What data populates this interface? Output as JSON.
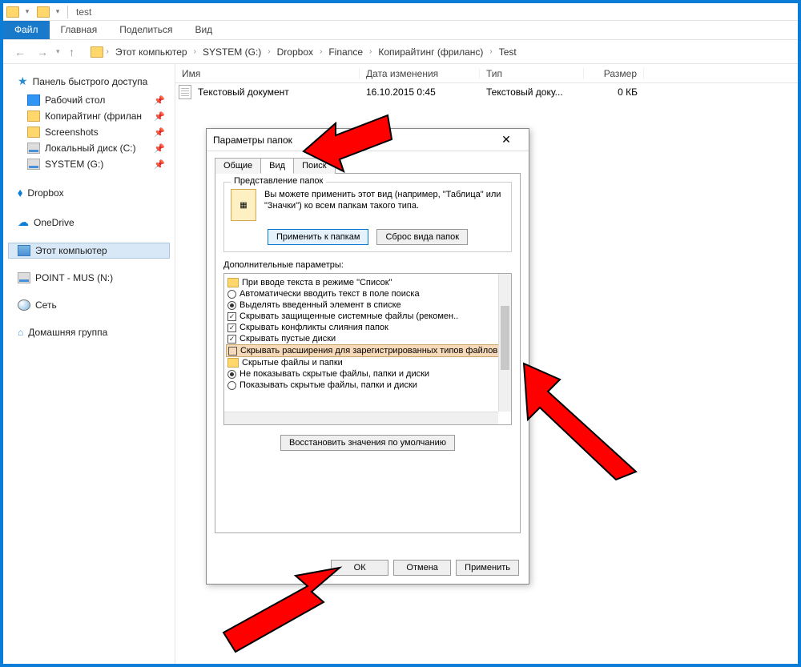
{
  "title": "test",
  "ribbon": {
    "file": "Файл",
    "home": "Главная",
    "share": "Поделиться",
    "view": "Вид"
  },
  "breadcrumb": [
    "Этот компьютер",
    "SYSTEM (G:)",
    "Dropbox",
    "Finance",
    "Копирайтинг (фриланс)",
    "Test"
  ],
  "columns": {
    "name": "Имя",
    "date": "Дата изменения",
    "type": "Тип",
    "size": "Размер"
  },
  "file": {
    "name": "Текстовый документ",
    "date": "16.10.2015 0:45",
    "type": "Текстовый доку...",
    "size": "0 КБ"
  },
  "sidebar": {
    "quick": "Панель быстрого доступа",
    "items": [
      {
        "label": "Рабочий стол"
      },
      {
        "label": "Копирайтинг (фрилан"
      },
      {
        "label": "Screenshots"
      },
      {
        "label": "Локальный диск (C:)"
      },
      {
        "label": "SYSTEM (G:)"
      }
    ],
    "dropbox": "Dropbox",
    "onedrive": "OneDrive",
    "thispc": "Этот компьютер",
    "point": "POINT - MUS (N:)",
    "network": "Сеть",
    "homegroup": "Домашняя группа"
  },
  "dialog": {
    "title": "Параметры папок",
    "tabs": {
      "general": "Общие",
      "view": "Вид",
      "search": "Поиск"
    },
    "gb1_title": "Представление папок",
    "gb1_text": "Вы можете применить этот вид (например, \"Таблица\" или \"Значки\") ко всем папкам такого типа.",
    "apply_folders": "Применить к папкам",
    "reset_folders": "Сброс вида папок",
    "adv_label": "Дополнительные параметры:",
    "tree": {
      "n0": "При вводе текста в режиме \"Список\"",
      "n1": "Автоматически вводить текст в поле поиска",
      "n2": "Выделять введенный элемент в списке",
      "n3": "Скрывать защищенные системные файлы (рекомен..",
      "n4": "Скрывать конфликты слияния папок",
      "n5": "Скрывать пустые диски",
      "n6": "Скрывать расширения для зарегистрированных типов файлов",
      "n7": "Скрытые файлы и папки",
      "n8": "Не показывать скрытые файлы, папки и диски",
      "n9": "Показывать скрытые файлы, папки и диски"
    },
    "restore": "Восстановить значения по умолчанию",
    "ok": "ОК",
    "cancel": "Отмена",
    "apply": "Применить"
  }
}
